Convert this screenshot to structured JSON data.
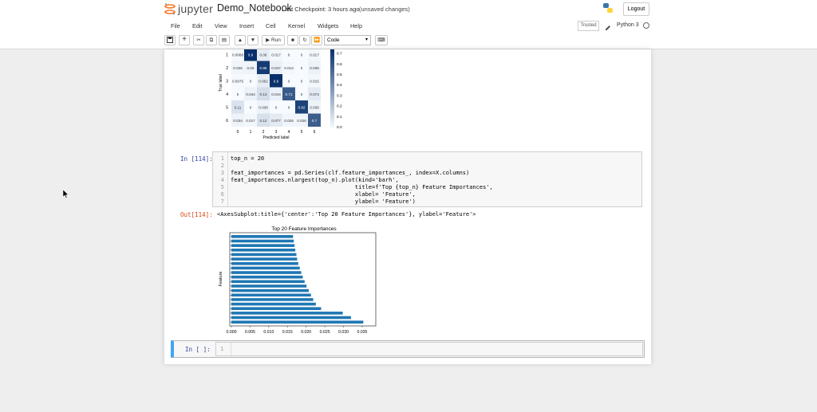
{
  "header": {
    "app": "jupyter",
    "notebook_name": "Demo_Notebook",
    "checkpoint": "Last Checkpoint: 3 hours ago",
    "unsaved": "(unsaved changes)",
    "logout": "Logout",
    "trusted": "Trusted",
    "kernel": "Python 3",
    "menu": [
      "File",
      "Edit",
      "View",
      "Insert",
      "Cell",
      "Kernel",
      "Widgets",
      "Help"
    ],
    "run_label": "Run",
    "cell_type": "Code"
  },
  "confusion_matrix": {
    "ylabel": "True label",
    "xlabel": "Predicted label",
    "ticks": [
      "0",
      "1",
      "2",
      "3",
      "4",
      "5",
      "6"
    ],
    "row_ticks": [
      "1",
      "2",
      "3",
      "4",
      "5",
      "6"
    ],
    "values": [
      [
        "0.0088",
        "0.9",
        "0.06",
        "0.017",
        "0",
        "0",
        "0.017"
      ],
      [
        "0.026",
        "0.03",
        "0.85",
        "0.047",
        "0.013",
        "0",
        "0.038"
      ],
      [
        "0.0075",
        "0",
        "0.062",
        "0.9",
        "0",
        "0",
        "0.015"
      ],
      [
        "0",
        "0.044",
        "0.13",
        "0.044",
        "0.71",
        "0",
        "0.074"
      ],
      [
        "0.11",
        "0",
        "0.036",
        "0",
        "0",
        "0.82",
        "0.036"
      ],
      [
        "0.034",
        "0.017",
        "0.12",
        "0.077",
        "0.026",
        "0.026",
        "0.7"
      ]
    ],
    "colorbar_ticks": [
      "0.7",
      "0.6",
      "0.5",
      "0.4",
      "0.3",
      "0.2",
      "0.1",
      "0.0"
    ]
  },
  "code_cell": {
    "prompt": "In [114]:",
    "lines": [
      {
        "n": "1",
        "text": "top_n = 20"
      },
      {
        "n": "2",
        "text": ""
      },
      {
        "n": "3",
        "text": "feat_importances = pd.Series(clf.feature_importances_, index=X.columns)"
      },
      {
        "n": "4",
        "text": "feat_importances.nlargest(top_n).plot(kind='barh',"
      },
      {
        "n": "5",
        "text": "                                     title=f'Top {top_n} Feature Importances',"
      },
      {
        "n": "6",
        "text": "                                     xlabel= 'Feature',"
      },
      {
        "n": "7",
        "text": "                                     ylabel= 'Feature')"
      }
    ]
  },
  "output": {
    "prompt": "Out[114]:",
    "text": "<AxesSubplot:title={'center':'Top 20 Feature Importances'}, ylabel='Feature'>"
  },
  "chart_data": {
    "type": "bar",
    "orientation": "horizontal",
    "title": "Top 20 Feature Importances",
    "xlabel": "",
    "ylabel": "Feature",
    "xticks": [
      "0.000",
      "0.005",
      "0.010",
      "0.015",
      "0.020",
      "0.025",
      "0.030",
      "0.035"
    ],
    "xlim": [
      0,
      0.038
    ],
    "values": [
      0.0165,
      0.0167,
      0.0169,
      0.0171,
      0.0174,
      0.0176,
      0.0179,
      0.0183,
      0.0187,
      0.0191,
      0.0196,
      0.0201,
      0.0207,
      0.0213,
      0.0219,
      0.0226,
      0.024,
      0.0298,
      0.032,
      0.0353
    ],
    "bar_color": "#1f77b4",
    "grid": false
  },
  "empty_cell": {
    "prompt": "In [ ]:",
    "line": "1"
  }
}
